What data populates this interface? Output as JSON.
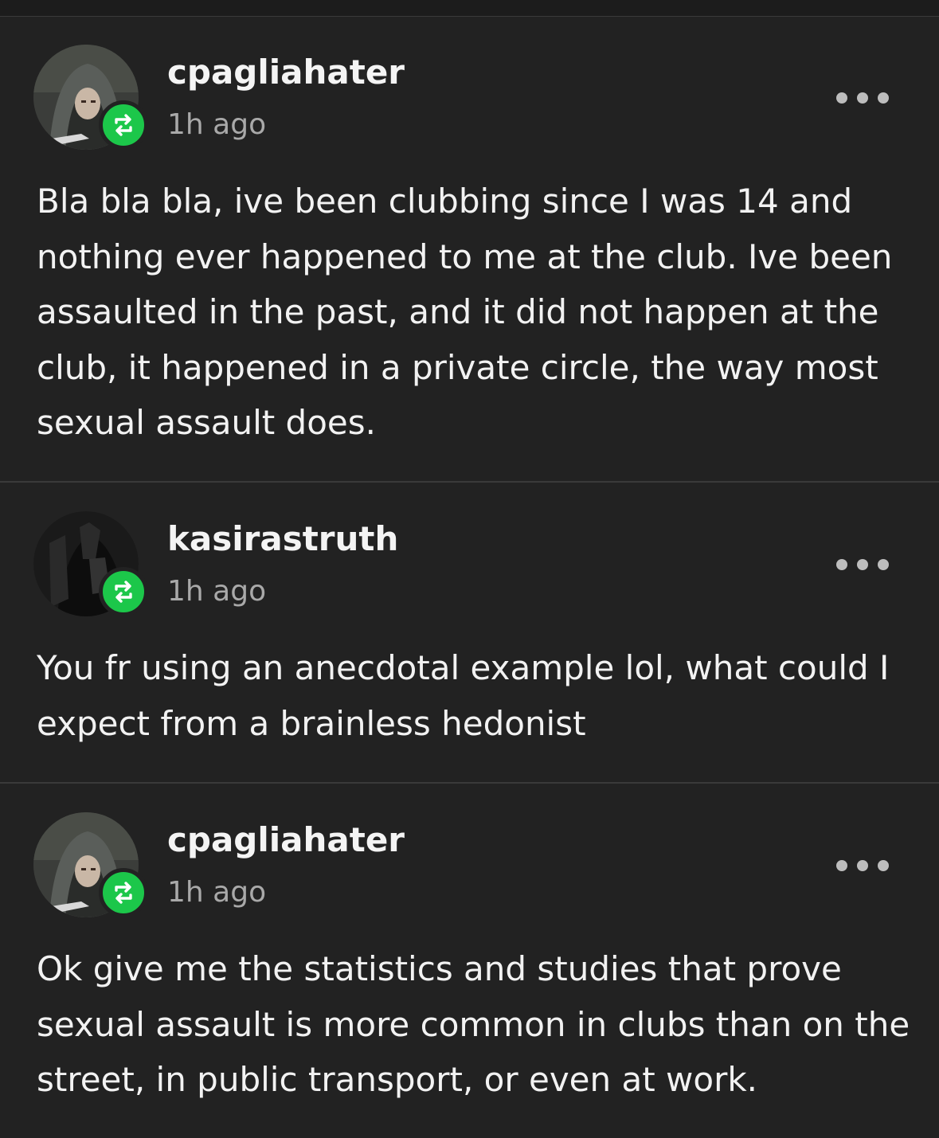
{
  "theme": {
    "background": "#222222",
    "divider": "#3a3a3a",
    "reblog_badge_color": "#1cc74a",
    "text": "#f2f2f2",
    "muted_text": "#a9a9a9"
  },
  "posts": [
    {
      "username": "cpagliahater",
      "time": "1h ago",
      "avatar_icon": "hooded-figure-avatar",
      "badge_icon": "reblog-icon",
      "menu_icon": "more-options-icon",
      "text": "Bla bla bla, ive been clubbing since I was 14 and nothing ever happened to me at the club. Ive been assaulted in the past, and it did not happen at the club, it happened in a private circle, the way most sexual assault does."
    },
    {
      "username": "kasirastruth",
      "time": "1h ago",
      "avatar_icon": "dark-figure-avatar",
      "badge_icon": "reblog-icon",
      "menu_icon": "more-options-icon",
      "text": "You fr using an anecdotal example lol, what could I expect from a brainless hedonist"
    },
    {
      "username": "cpagliahater",
      "time": "1h ago",
      "avatar_icon": "hooded-figure-avatar",
      "badge_icon": "reblog-icon",
      "menu_icon": "more-options-icon",
      "text": "Ok give me the statistics and studies that prove sexual assault is more common in clubs than on the street, in public transport, or even at work."
    }
  ]
}
